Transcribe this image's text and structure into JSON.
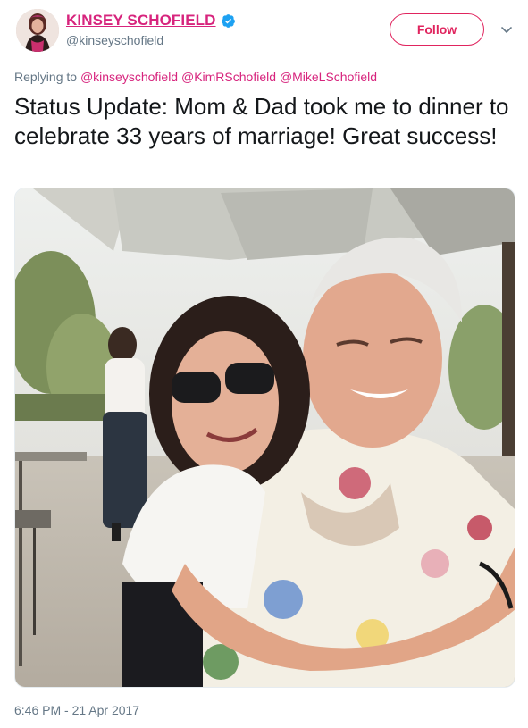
{
  "user": {
    "display_name": "KINSEY SCHOFIELD",
    "handle": "@kinseyschofield",
    "verified": true
  },
  "actions": {
    "follow_label": "Follow"
  },
  "reply": {
    "prefix": "Replying to",
    "mentions": [
      "@kinseyschofield",
      "@KimRSchofield",
      "@MikeLSchofield"
    ]
  },
  "tweet": {
    "text": "Status Update: Mom & Dad took me to dinner to celebrate 33 years of marriage! Great success!"
  },
  "timestamp": "6:46 PM - 21 Apr 2017",
  "colors": {
    "brand": "#d7247d",
    "follow": "#e0245e",
    "verified": "#1da1f2",
    "muted": "#657786"
  },
  "icons": [
    "verified-badge-icon",
    "chevron-down-icon"
  ]
}
